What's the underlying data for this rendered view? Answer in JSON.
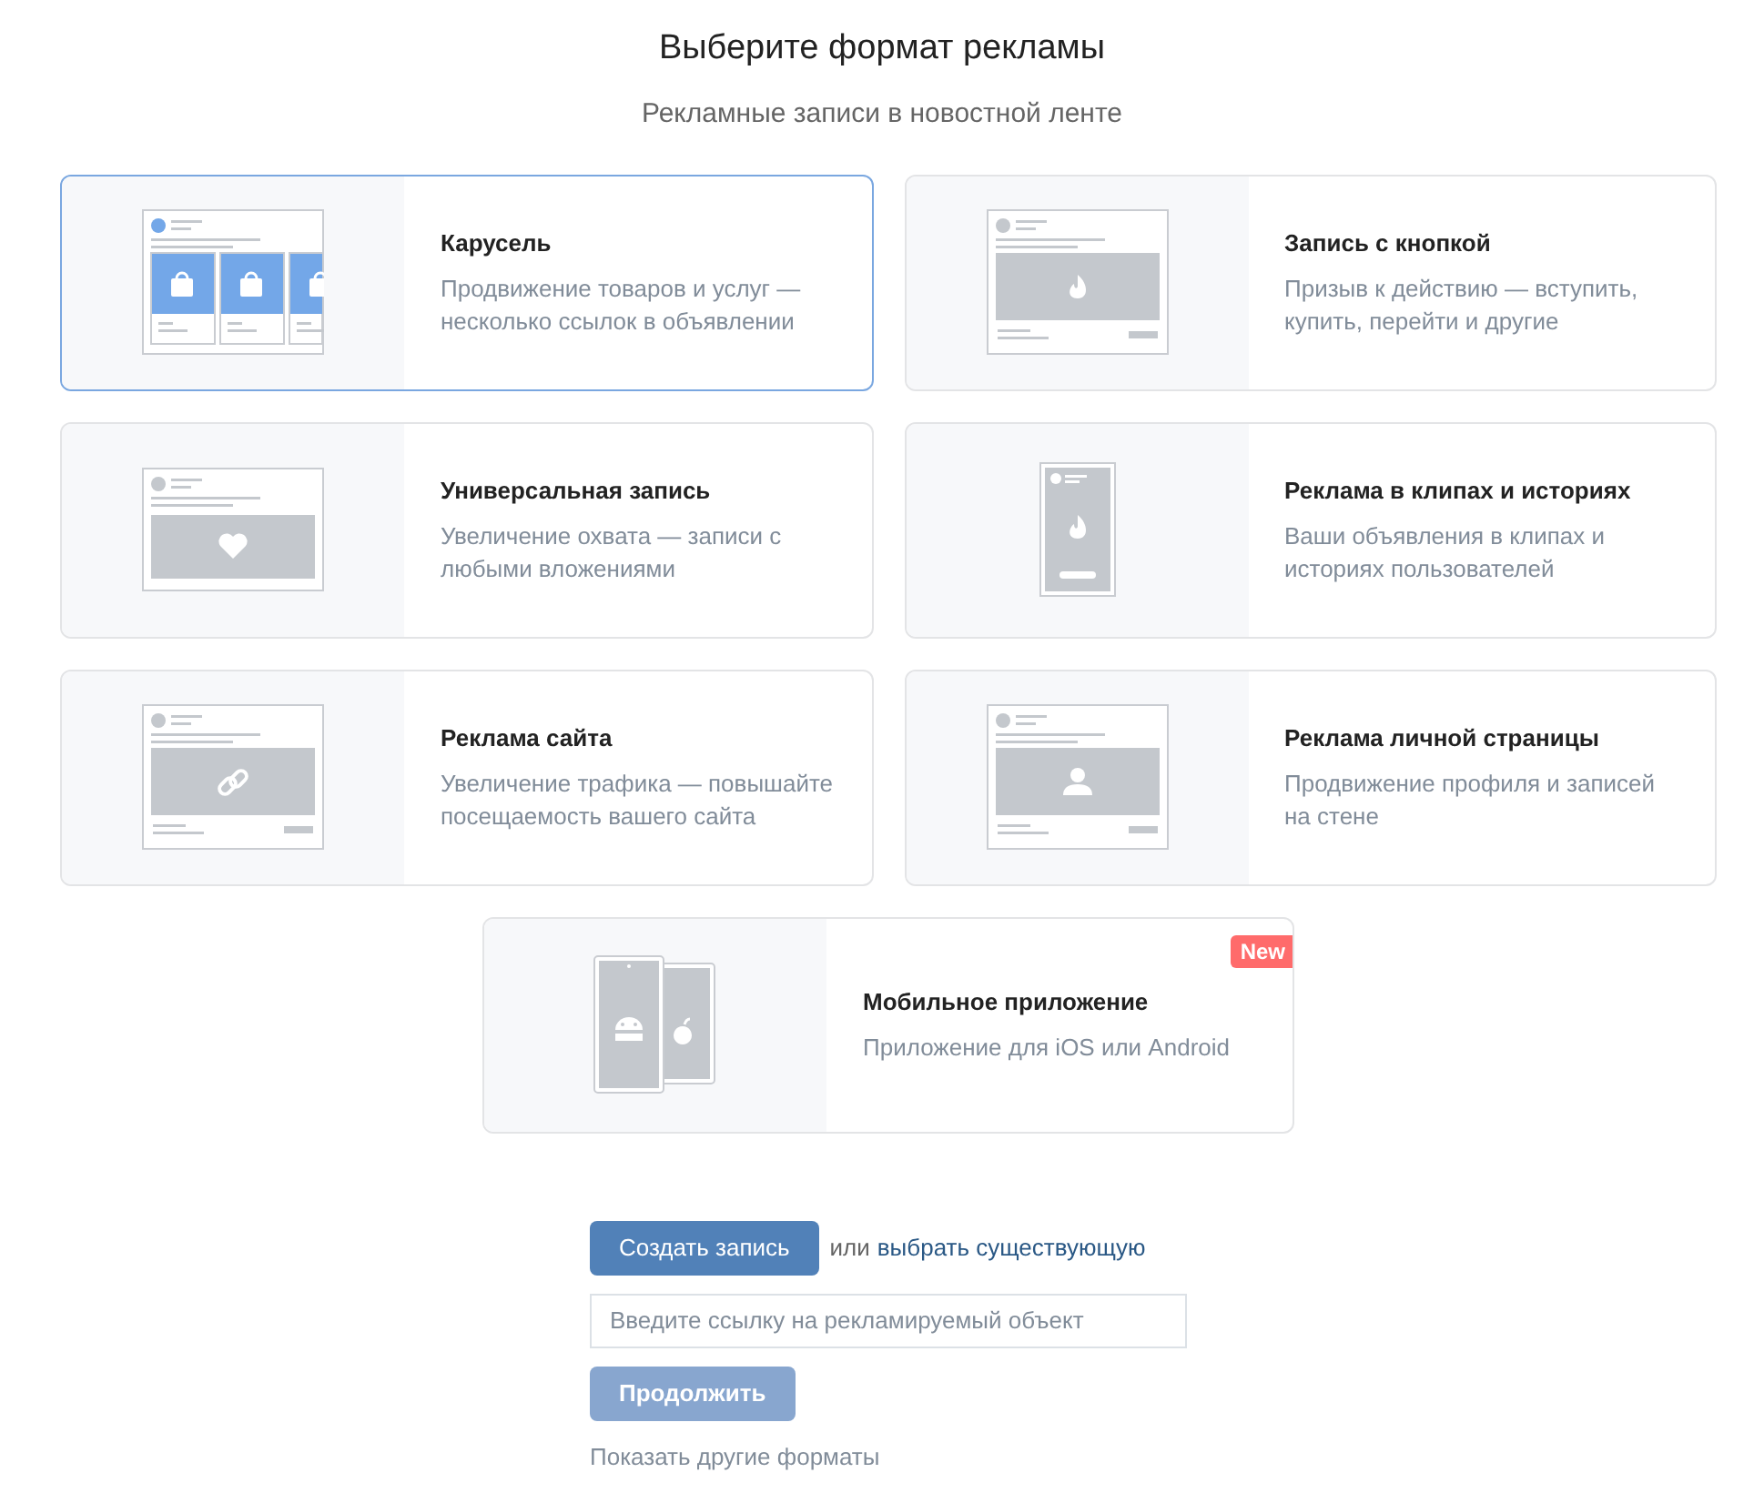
{
  "title": "Выберите формат рекламы",
  "subtitle": "Рекламные записи в новостной ленте",
  "formats": [
    {
      "kind": "carousel",
      "title": "Карусель",
      "description": "Продвижение товаров и услуг — несколько ссылок в объявлении",
      "selected": true
    },
    {
      "kind": "button_post",
      "title": "Запись с кнопкой",
      "description": "Призыв к действию — вступить, купить, перейти и другие",
      "selected": false
    },
    {
      "kind": "universal",
      "title": "Универсальная запись",
      "description": "Увеличение охвата — записи с любыми вложениями",
      "selected": false
    },
    {
      "kind": "clips",
      "title": "Реклама в клипах и историях",
      "description": "Ваши объявления в клипах и историях пользователей",
      "selected": false
    },
    {
      "kind": "site",
      "title": "Реклама сайта",
      "description": "Увеличение трафика — повышайте посещаемость вашего сайта",
      "selected": false
    },
    {
      "kind": "profile",
      "title": "Реклама личной страницы",
      "description": "Продвижение профиля и записей на стене",
      "selected": false
    },
    {
      "kind": "app",
      "title": "Мобильное приложение",
      "description": "Приложение для iOS или Android",
      "selected": false,
      "badge": "New"
    }
  ],
  "create_button": {
    "label": "Создать запись",
    "disabled": false
  },
  "or_text": "или",
  "choose_link": "выбрать существующую",
  "link_field": {
    "placeholder": "Введите ссылку на рекламируемый объект"
  },
  "continue_button": {
    "label": "Продолжить",
    "disabled": true
  },
  "more_link": "Показать другие форматы"
}
